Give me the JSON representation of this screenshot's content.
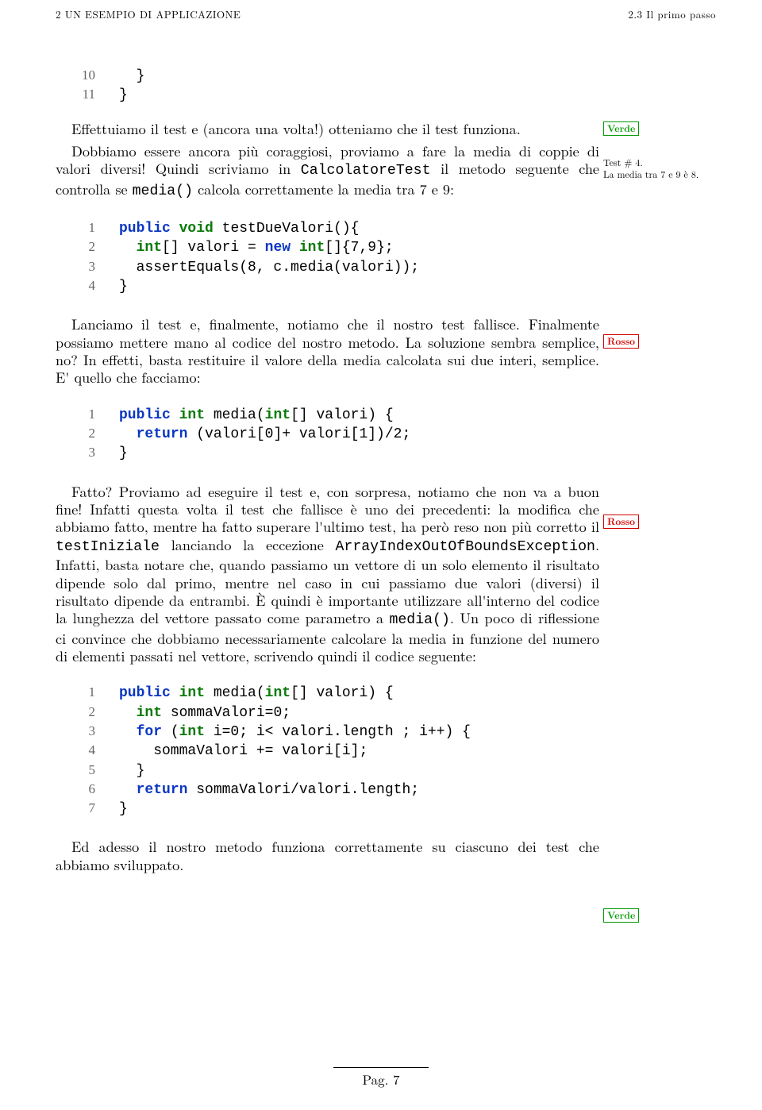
{
  "header": {
    "left": "2   UN ESEMPIO DI APPLICAZIONE",
    "right": "2.3   Il primo passo"
  },
  "margin": {
    "verde": "Verde",
    "rosso": "Rosso",
    "note_test4_a": "Test # 4.",
    "note_test4_b": "La media tra 7 e 9 è 8."
  },
  "code0": {
    "l10_n": "10",
    "l10_t": "  }",
    "l11_n": "11",
    "l11_t": "}"
  },
  "para1": "Effettuiamo il test e (ancora una volta!) otteniamo che il test funziona.",
  "para2_a": "Dobbiamo essere ancora più coraggiosi, proviamo a fare la media di coppie di valori diversi! Quindi scriviamo in ",
  "para2_b": "CalcolatoreTest",
  "para2_c": " il metodo seguente che controlla se ",
  "para2_d": "media()",
  "para2_e": " calcola correttamente la media tra 7 e 9:",
  "code1": {
    "l1_n": "1",
    "l1_kw1": "public",
    "l1_kw2": "void",
    "l1_rest": " testDueValori(){",
    "l2_n": "2",
    "l2_kw1": "int",
    "l2_mid": "[] valori = ",
    "l2_kw2": "new",
    "l2_sp": " ",
    "l2_kw3": "int",
    "l2_end": "[]{7,9};",
    "l3_n": "3",
    "l3_t": "  assertEquals(8, c.media(valori));",
    "l4_n": "4",
    "l4_t": "}"
  },
  "para3": "Lanciamo il test e, finalmente, notiamo che il nostro test fallisce. Finalmente possiamo mettere mano al codice del nostro metodo. La soluzione sembra semplice, no? In effetti, basta restituire il valore della media calcolata sui due interi, semplice. E' quello che facciamo:",
  "code2": {
    "l1_n": "1",
    "l1_kw1": "public",
    "l1_sp1": " ",
    "l1_kw2": "int",
    "l1_mid": " media(",
    "l1_kw3": "int",
    "l1_end": "[] valori) {",
    "l2_n": "2",
    "l2_kw": "return",
    "l2_rest": " (valori[0]+ valori[1])/2;",
    "l3_n": "3",
    "l3_t": "}"
  },
  "para4_a": "Fatto? Proviamo ad eseguire il test e, con sorpresa, notiamo che non va a buon fine! Infatti questa volta il test che fallisce è uno dei precedenti: la modifica che abbiamo fatto, mentre ha fatto superare l'ultimo test, ha però reso non più corretto il ",
  "para4_b": "testIniziale",
  "para4_c": " lanciando la eccezione ",
  "para4_d": "ArrayIndexOutOfBoundsException",
  "para4_e": ". Infatti, basta notare che, quando passiamo un vettore di un solo elemento il risultato dipende solo dal primo, mentre nel caso in cui passiamo due valori (diversi) il risultato dipende da entrambi. È quindi è importante utilizzare all'interno del codice la lunghezza del vettore passato come parametro a ",
  "para4_f": "media()",
  "para4_g": ". Un poco di riflessione ci convince che dobbiamo necessariamente calcolare la media in funzione del numero di elementi passati nel vettore, scrivendo quindi il codice seguente:",
  "code3": {
    "l1_n": "1",
    "l1_kw1": "public",
    "l1_sp1": " ",
    "l1_kw2": "int",
    "l1_mid": " media(",
    "l1_kw3": "int",
    "l1_end": "[] valori) {",
    "l2_n": "2",
    "l2_kw": "int",
    "l2_rest": " sommaValori=0;",
    "l3_n": "3",
    "l3_kw1": "for",
    "l3_mid": " (",
    "l3_kw2": "int",
    "l3_rest": " i=0; i< valori.length ; i++) {",
    "l4_n": "4",
    "l4_t": "    sommaValori += valori[i];",
    "l5_n": "5",
    "l5_t": "  }",
    "l6_n": "6",
    "l6_kw": "return",
    "l6_rest": " sommaValori/valori.length;",
    "l7_n": "7",
    "l7_t": "}"
  },
  "para5": "Ed adesso il nostro metodo funziona correttamente su ciascuno dei test che abbiamo sviluppato.",
  "footer": "Pag. 7"
}
